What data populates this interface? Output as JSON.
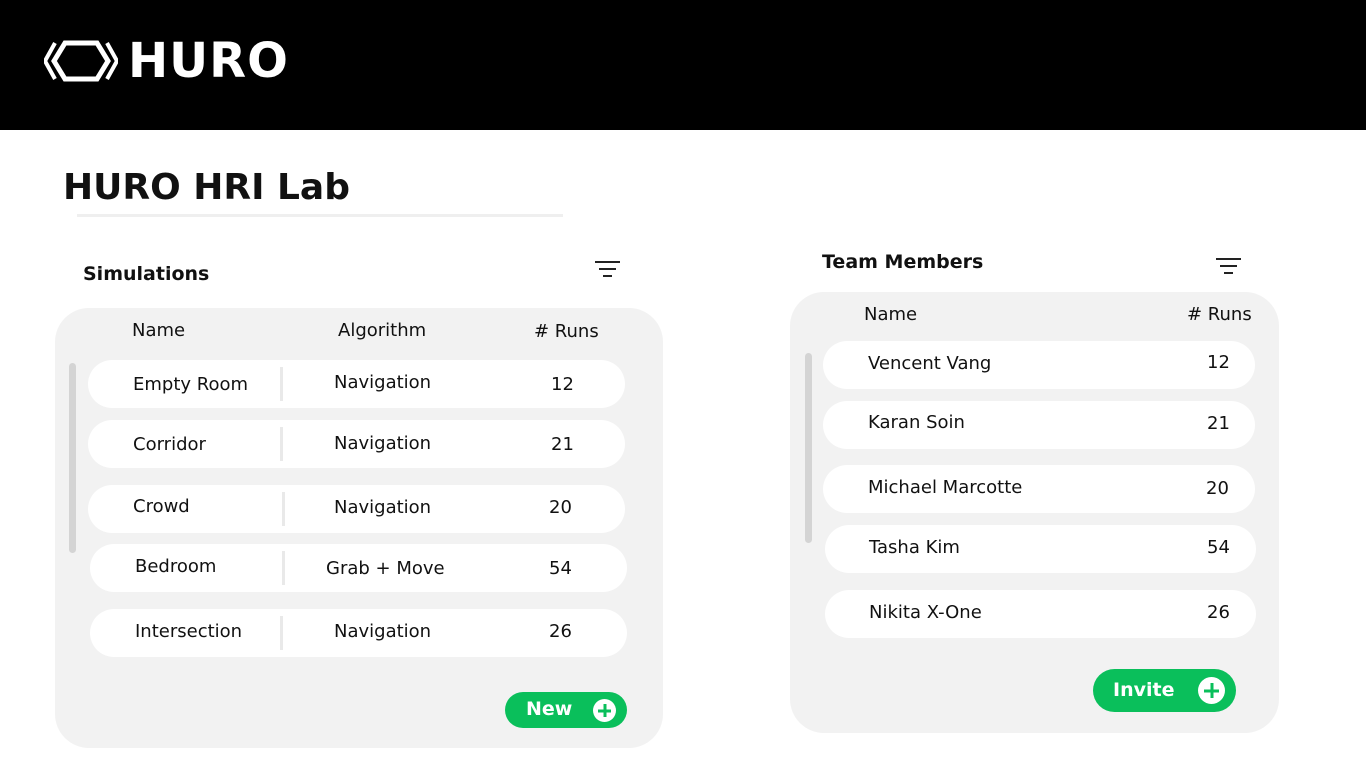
{
  "header": {
    "brand": "HURO",
    "logo_icon": "huro-hexagon-logo-icon"
  },
  "page": {
    "title": "HURO HRI Lab"
  },
  "simulations": {
    "label": "Simulations",
    "filter_icon": "filter-icon",
    "columns": {
      "name": "Name",
      "algorithm": "Algorithm",
      "runs": "# Runs"
    },
    "rows": [
      {
        "name": "Empty Room",
        "algorithm": "Navigation",
        "runs": "12"
      },
      {
        "name": "Corridor",
        "algorithm": "Navigation",
        "runs": "21"
      },
      {
        "name": "Crowd",
        "algorithm": "Navigation",
        "runs": "20"
      },
      {
        "name": "Bedroom",
        "algorithm": "Grab + Move",
        "runs": "54"
      },
      {
        "name": "Intersection",
        "algorithm": "Navigation",
        "runs": "26"
      }
    ],
    "new_button": {
      "label": "New",
      "icon": "plus-circle-icon"
    }
  },
  "team": {
    "label": "Team Members",
    "filter_icon": "filter-icon",
    "columns": {
      "name": "Name",
      "runs": "# Runs"
    },
    "rows": [
      {
        "name": "Vencent Vang",
        "runs": "12"
      },
      {
        "name": "Karan Soin",
        "runs": "21"
      },
      {
        "name": "Michael Marcotte",
        "runs": "20"
      },
      {
        "name": "Tasha Kim",
        "runs": "54"
      },
      {
        "name": "Nikita X-One",
        "runs": "26"
      }
    ],
    "invite_button": {
      "label": "Invite",
      "icon": "plus-circle-icon"
    }
  },
  "colors": {
    "accent_green": "#0abf5b",
    "header_bg": "#000000",
    "panel_bg": "#f2f2f2"
  }
}
